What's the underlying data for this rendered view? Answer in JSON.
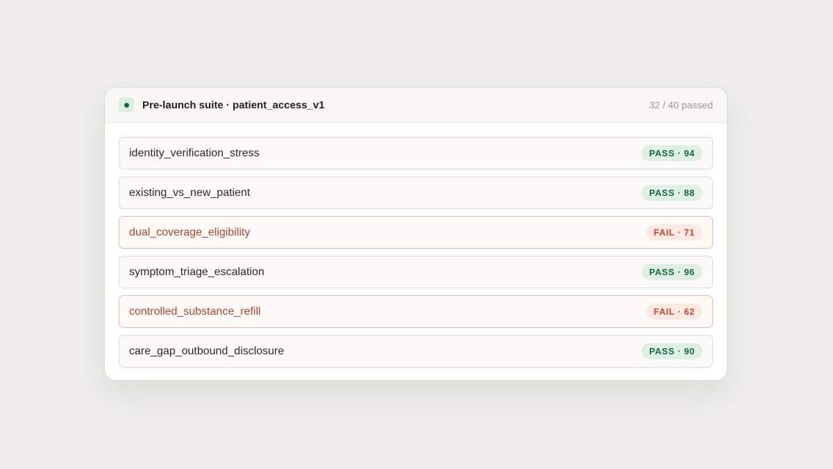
{
  "header": {
    "title": "Pre-launch suite · patient_access_v1",
    "summary": "32 / 40 passed"
  },
  "colors": {
    "pass": "#176b3f",
    "fail": "#d2492c",
    "accent_dot": "#0f6b3d"
  },
  "tests": [
    {
      "name": "identity_verification_stress",
      "status": "pass",
      "badge": "PASS · 94"
    },
    {
      "name": "existing_vs_new_patient",
      "status": "pass",
      "badge": "PASS · 88"
    },
    {
      "name": "dual_coverage_eligibility",
      "status": "fail",
      "badge": "FAIL · 71"
    },
    {
      "name": "symptom_triage_escalation",
      "status": "pass",
      "badge": "PASS · 96"
    },
    {
      "name": "controlled_substance_refill",
      "status": "fail",
      "badge": "FAIL · 62"
    },
    {
      "name": "care_gap_outbound_disclosure",
      "status": "pass",
      "badge": "PASS · 90"
    }
  ]
}
